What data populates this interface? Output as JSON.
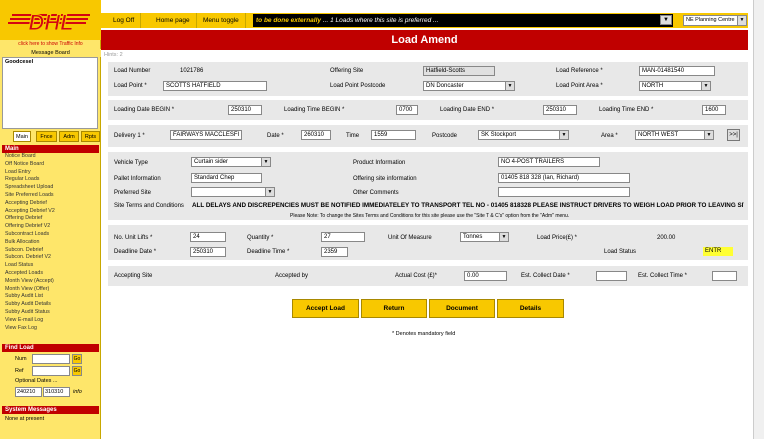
{
  "sidebar": {
    "logo_text": "DHL",
    "traffic_link": "click here to show Traffic Info",
    "message_board_title": "Message Board",
    "message_board_text": "Goodcesel",
    "tabs": [
      "Main",
      "Fnce",
      "Adm",
      "Rpts"
    ],
    "menu_title": "Main",
    "menu_items": [
      "Notice Board",
      "Off Notice Board",
      "Load Entry",
      "Regular Loads",
      "Spreadsheet Upload",
      "Site Preferred Loads",
      "Accepting Debrief",
      "Accepting Debrief V2",
      "Offering Debrief",
      "Offering Debrief V2",
      "Subcontract Loads",
      "Bulk Allocation",
      "Subcon. Debrief",
      "Subcon. Debrief V2",
      "Load Status",
      "Accepted Loads",
      "Month View (Accept)",
      "Month View (Offer)",
      "Subby Audit List",
      "Subby Audit Details",
      "Subby Audit Status",
      "View E-mail Log",
      "View Fax Log"
    ],
    "find_title": "Find Load",
    "find_num_label": "Num",
    "find_ref_label": "Ref",
    "go_label": "Go",
    "optional_dates_label": "Optional Dates ...",
    "date_from": "240210",
    "date_to": "310310",
    "info_label": "info",
    "sys_title": "System Messages",
    "sys_text": "None at present"
  },
  "topbar": {
    "logoff": "Log Off",
    "home": "Home page",
    "menu_toggle": "Menu toggle",
    "ticker_a": "to be done externally",
    "ticker_b": "... 1 Loads where this site is preferred ...",
    "centre": "NE Planning Centre"
  },
  "header": {
    "title": "Load Amend"
  },
  "hint": "Hints:  2",
  "load": {
    "number_label": "Load Number",
    "number": "1021786",
    "offering_site_label": "Offering Site",
    "offering_site": "Hatfield-Scotts",
    "reference_label": "Load Reference *",
    "reference": "MAN-01481540",
    "point_label": "Load Point *",
    "point": "SCOTTS HATFIELD",
    "postcode_label": "Load Point Postcode",
    "postcode": "DN Doncaster",
    "area_label": "Load Point Area *",
    "area": "NORTH"
  },
  "dates": {
    "begin_label": "Loading Date BEGIN *",
    "begin": "250310",
    "time_begin_label": "Loading Time BEGIN *",
    "time_begin": "0700",
    "end_label": "Loading Date END *",
    "end": "250310",
    "time_end_label": "Loading Time END *",
    "time_end": "1600"
  },
  "delivery": {
    "label": "Delivery 1 *",
    "value": "FAIRWAYS MACCLESFI",
    "date_label": "Date *",
    "date": "260310",
    "time_label": "Time",
    "time": "1559",
    "postcode_label": "Postcode",
    "postcode": "SK Stockport",
    "area_label": "Area *",
    "area": "NORTH WEST",
    "more": ">>|"
  },
  "vehicle": {
    "type_label": "Vehicle Type",
    "type": "Curtain sider",
    "product_label": "Product Information",
    "product": "NO 4-POST TRAILERS",
    "pallet_label": "Pallet Information",
    "pallet": "Standard Chep",
    "offering_info_label": "Offering site information",
    "offering_info": "01405 818 328 (Ian, Richard)",
    "preferred_label": "Preferred Site",
    "preferred": "",
    "comments_label": "Other Comments",
    "comments": "",
    "terms_label": "Site Terms and Conditions",
    "terms": "ALL DELAYS AND DISCREPENCIES MUST BE NOTIFIED IMMEDIATELEY TO TRANSPORT TEL NO - 01405 818328 PLEASE INSTRUCT DRIVERS TO WEIGH LOAD PRIOR TO LEAVING SITE",
    "terms_note": "Please Note: To change the Sites Terms and Conditions for this site please use the \"Site T & C's\" option from the \"Adm\" menu."
  },
  "quantity": {
    "lifts_label": "No. Unit Lifts *",
    "lifts": "24",
    "qty_label": "Quantity *",
    "qty": "27",
    "uom_label": "Unit Of Measure",
    "uom": "Tonnes",
    "price_label": "Load Price(£) *",
    "price": "200.00",
    "deadline_date_label": "Deadline Date *",
    "deadline_date": "250310",
    "deadline_time_label": "Deadline Time *",
    "deadline_time": "2359",
    "status_label": "Load Status",
    "status": "ENTR"
  },
  "accept": {
    "site_label": "Accepting Site",
    "by_label": "Accepted by",
    "cost_label": "Actual Cost (£)*",
    "cost": "0.00",
    "collect_date_label": "Est. Collect Date *",
    "collect_date": "",
    "collect_time_label": "Est. Collect Time *",
    "collect_time": ""
  },
  "buttons": {
    "accept": "Accept Load",
    "return": "Return",
    "document": "Document",
    "details": "Details"
  },
  "footer_note": "* Denotes mandatory field",
  "colors": {
    "dhl_yellow": "#f8c800",
    "dhl_red": "#c00000"
  }
}
